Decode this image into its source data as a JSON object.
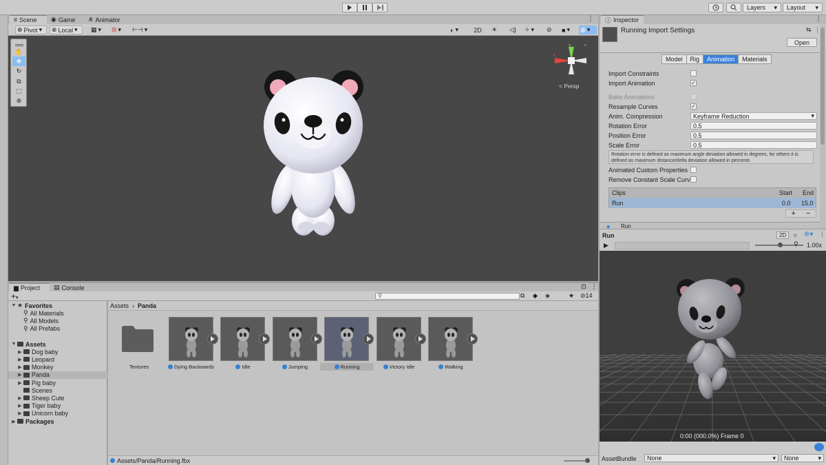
{
  "toolbar": {
    "layers_label": "Layers",
    "layout_label": "Layout",
    "play_icon": "play-icon",
    "pause_icon": "pause-icon",
    "step_icon": "step-icon"
  },
  "scene_tabs": [
    {
      "label": "Scene",
      "icon": "scene-icon",
      "active": true
    },
    {
      "label": "Game",
      "icon": "game-icon",
      "active": false
    },
    {
      "label": "Animator",
      "icon": "animator-icon",
      "active": false
    }
  ],
  "scene_toolbar": {
    "pivot_label": "Pivot",
    "local_label": "Local",
    "mode_2d_label": "2D"
  },
  "gizmo": {
    "persp_label": "< Persp",
    "axis_y": "y",
    "axis_x": "x"
  },
  "inspector": {
    "tab_label": "Inspector",
    "title": "Running Import Settings",
    "open_button": "Open",
    "tabs": [
      {
        "label": "Model",
        "active": false
      },
      {
        "label": "Rig",
        "active": false
      },
      {
        "label": "Animation",
        "active": true
      },
      {
        "label": "Materials",
        "active": false
      }
    ],
    "props": [
      {
        "label": "Import Constraints",
        "type": "check",
        "checked": false,
        "disabled": false
      },
      {
        "label": "Import Animation",
        "type": "check",
        "checked": true,
        "disabled": false
      },
      {
        "label": "Bake Animations",
        "type": "check",
        "checked": false,
        "disabled": true
      },
      {
        "label": "Resample Curves",
        "type": "check",
        "checked": true,
        "disabled": false
      },
      {
        "label": "Anim. Compression",
        "type": "select",
        "value": "Keyframe Reduction"
      },
      {
        "label": "Rotation Error",
        "type": "field",
        "value": "0.5"
      },
      {
        "label": "Position Error",
        "type": "field",
        "value": "0.5"
      },
      {
        "label": "Scale Error",
        "type": "field",
        "value": "0.5"
      }
    ],
    "help_text": "Rotation error is defined as maximum angle deviation allowed in degrees, for others it is defined as maximum distance/delta deviation allowed in percents",
    "props2": [
      {
        "label": "Animated Custom Properties",
        "checked": false
      },
      {
        "label": "Remove Constant Scale Curv",
        "checked": false
      }
    ],
    "clips": {
      "header": "Clips",
      "start_header": "Start",
      "end_header": "End",
      "rows": [
        {
          "name": "Run",
          "start": "0.0",
          "end": "15.0"
        }
      ]
    },
    "add_label": "+",
    "remove_label": "−",
    "next_clip_label": "Run"
  },
  "preview": {
    "title": "Run",
    "mode_2d_label": "2D",
    "speed": "1.00x",
    "playback_progress": 0,
    "status": "0:00 (000.0%) Frame 0"
  },
  "asset_bundle": {
    "label": "AssetBundle",
    "value": "None",
    "variant_value": "None"
  },
  "project": {
    "tabs": [
      {
        "label": "Project",
        "active": true
      },
      {
        "label": "Console",
        "active": false
      }
    ],
    "add_label": "+",
    "hidden_count": "14",
    "tree": [
      {
        "label": "Favorites",
        "level": 0,
        "bold": true,
        "expanded": true,
        "kind": "star",
        "selected": false
      },
      {
        "label": "All Materials",
        "level": 1,
        "bold": false,
        "expanded": null,
        "kind": "search",
        "selected": false
      },
      {
        "label": "All Models",
        "level": 1,
        "bold": false,
        "expanded": null,
        "kind": "search",
        "selected": false
      },
      {
        "label": "All Prefabs",
        "level": 1,
        "bold": false,
        "expanded": null,
        "kind": "search",
        "selected": false
      },
      {
        "label": "",
        "level": 0,
        "bold": false,
        "expanded": null,
        "kind": "spacer",
        "selected": false
      },
      {
        "label": "Assets",
        "level": 0,
        "bold": true,
        "expanded": true,
        "kind": "folder",
        "selected": false
      },
      {
        "label": "Dog baby",
        "level": 1,
        "bold": false,
        "expanded": false,
        "kind": "folder",
        "selected": false
      },
      {
        "label": "Leopard",
        "level": 1,
        "bold": false,
        "expanded": false,
        "kind": "folder",
        "selected": false
      },
      {
        "label": "Monkey",
        "level": 1,
        "bold": false,
        "expanded": false,
        "kind": "folder",
        "selected": false
      },
      {
        "label": "Panda",
        "level": 1,
        "bold": false,
        "expanded": false,
        "kind": "folder",
        "selected": true
      },
      {
        "label": "Pig baby",
        "level": 1,
        "bold": false,
        "expanded": false,
        "kind": "folder",
        "selected": false
      },
      {
        "label": "Scenes",
        "level": 1,
        "bold": false,
        "expanded": null,
        "kind": "folder",
        "selected": false
      },
      {
        "label": "Sheep Cute",
        "level": 1,
        "bold": false,
        "expanded": false,
        "kind": "folder",
        "selected": false
      },
      {
        "label": "Tiger baby",
        "level": 1,
        "bold": false,
        "expanded": false,
        "kind": "folder",
        "selected": false
      },
      {
        "label": "Unicorn baby",
        "level": 1,
        "bold": false,
        "expanded": false,
        "kind": "folder",
        "selected": false
      },
      {
        "label": "Packages",
        "level": 0,
        "bold": true,
        "expanded": false,
        "kind": "folder",
        "selected": false
      }
    ],
    "breadcrumb": [
      "Assets",
      "Panda"
    ],
    "assets": [
      {
        "name": "Textures",
        "kind": "folder",
        "selected": false
      },
      {
        "name": "Dying Backwards",
        "kind": "anim",
        "selected": false
      },
      {
        "name": "Idle",
        "kind": "anim",
        "selected": false
      },
      {
        "name": "Jumping",
        "kind": "anim",
        "selected": false
      },
      {
        "name": "Running",
        "kind": "anim",
        "selected": true
      },
      {
        "name": "Victory Idle",
        "kind": "anim",
        "selected": false
      },
      {
        "name": "Walking",
        "kind": "anim",
        "selected": false
      }
    ],
    "selected_path": "Assets/Panda/Running.fbx",
    "zoom_level": 0.95
  },
  "colors": {
    "accent": "#3a81d8",
    "viewport_bg": "#474747",
    "preview_bg": "#3e3e3e"
  }
}
